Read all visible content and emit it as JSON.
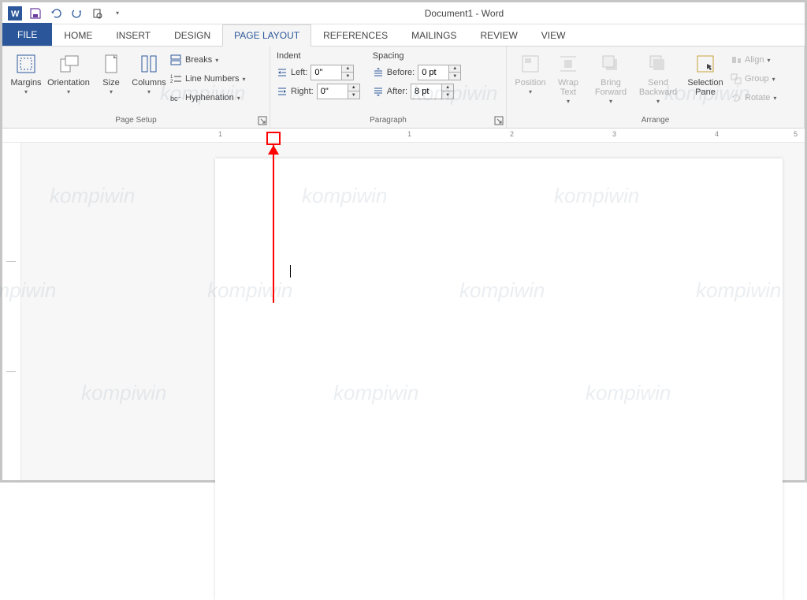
{
  "title": "Document1 - Word",
  "tabs": {
    "file": "FILE",
    "home": "HOME",
    "insert": "INSERT",
    "design": "DESIGN",
    "page_layout": "PAGE LAYOUT",
    "references": "REFERENCES",
    "mailings": "MAILINGS",
    "review": "REVIEW",
    "view": "VIEW"
  },
  "groups": {
    "page_setup": {
      "label": "Page Setup",
      "margins": "Margins",
      "orientation": "Orientation",
      "size": "Size",
      "columns": "Columns",
      "breaks": "Breaks",
      "line_numbers": "Line Numbers",
      "hyphenation": "Hyphenation"
    },
    "paragraph": {
      "label": "Paragraph",
      "indent": "Indent",
      "spacing": "Spacing",
      "left": "Left:",
      "right": "Right:",
      "before": "Before:",
      "after": "After:",
      "left_val": "0\"",
      "right_val": "0\"",
      "before_val": "0 pt",
      "after_val": "8 pt"
    },
    "arrange": {
      "label": "Arrange",
      "position": "Position",
      "wrap_text": "Wrap Text",
      "bring_forward": "Bring Forward",
      "send_backward": "Send Backward",
      "selection_pane": "Selection Pane",
      "align": "Align",
      "group": "Group",
      "rotate": "Rotate"
    }
  },
  "ruler": {
    "marks": [
      "1",
      "1",
      "2",
      "3",
      "4",
      "5"
    ]
  },
  "watermark": "kompiwin"
}
